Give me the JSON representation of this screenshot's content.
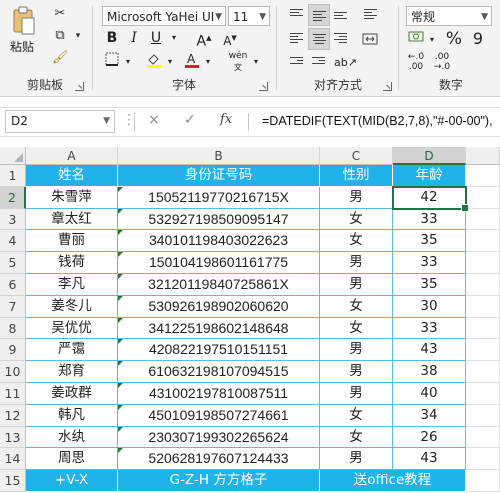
{
  "ribbon": {
    "clipboard": {
      "paste_label": "粘贴",
      "group_label": "剪贴板"
    },
    "font": {
      "font_name": "Microsoft YaHei UI",
      "font_size": "11",
      "bold_label": "B",
      "italic_label": "I",
      "underline_label": "U",
      "increase_font_label": "A",
      "decrease_font_label": "A",
      "phonetic_label": "wén",
      "group_label": "字体"
    },
    "alignment": {
      "group_label": "对齐方式"
    },
    "number": {
      "format": "常规",
      "percent_label": "%",
      "comma_label": "9",
      "group_label": "数字"
    }
  },
  "formula_bar": {
    "name_box": "D2",
    "cancel_icon": "×",
    "enter_icon": "✓",
    "fx_label": "fx",
    "formula": "=DATEDIF(TEXT(MID(B2,7,8),\"#-00-00\"),"
  },
  "columns": [
    "A",
    "B",
    "C",
    "D"
  ],
  "table": {
    "headers": [
      "姓名",
      "身份证号码",
      "性别",
      "年龄"
    ],
    "rows": [
      [
        "朱雪萍",
        "15052119770216715X",
        "男",
        "42"
      ],
      [
        "章太红",
        "532927198509095147",
        "女",
        "33"
      ],
      [
        "曹丽",
        "340101198403022623",
        "女",
        "35"
      ],
      [
        "钱荷",
        "150104198601161775",
        "男",
        "33"
      ],
      [
        "李凡",
        "32120119840725861X",
        "男",
        "35"
      ],
      [
        "姜冬儿",
        "530926198902060620",
        "女",
        "30"
      ],
      [
        "吴优优",
        "341225198602148648",
        "女",
        "33"
      ],
      [
        "严霭",
        "420822197510151151",
        "男",
        "43"
      ],
      [
        "郑育",
        "610632198107094515",
        "男",
        "38"
      ],
      [
        "姜政群",
        "431002197810087511",
        "男",
        "40"
      ],
      [
        "韩凡",
        "450109198507274661",
        "女",
        "34"
      ],
      [
        "水纨",
        "230307199302265624",
        "女",
        "26"
      ],
      [
        "周思",
        "520628197607124433",
        "男",
        "43"
      ]
    ],
    "footer": [
      "+V-X",
      "G-Z-H 方方格子",
      "送office教程",
      ""
    ]
  },
  "row_numbers": [
    "1",
    "2",
    "3",
    "4",
    "5",
    "6",
    "7",
    "8",
    "9",
    "10",
    "11",
    "12",
    "13",
    "14",
    "15"
  ],
  "colors": {
    "header_fill": "#1fb3e9",
    "selection": "#217346",
    "border": "#5bbbe0"
  }
}
